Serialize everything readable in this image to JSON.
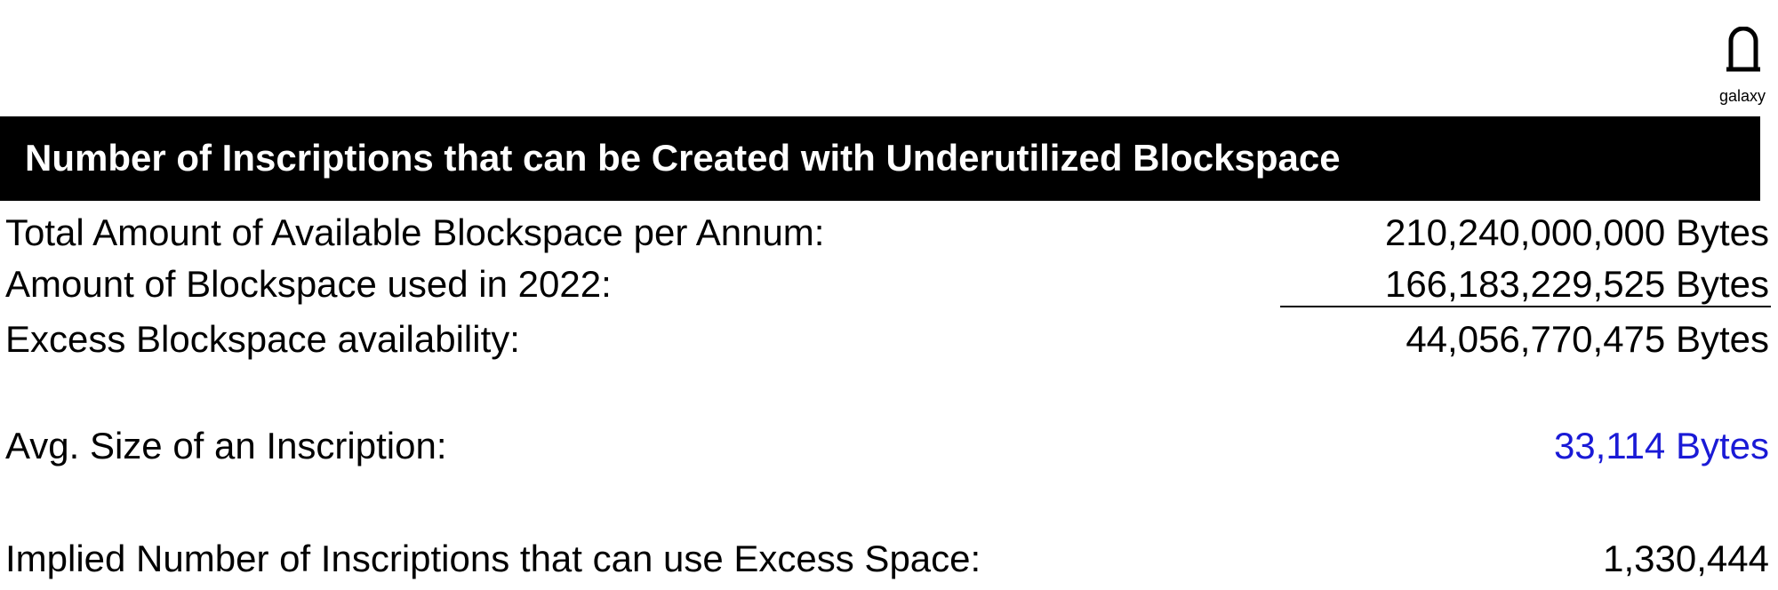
{
  "logo": {
    "icon": "galaxy-logo-icon",
    "text": "galaxy"
  },
  "header": {
    "title": "Number of Inscriptions that can be Created with Underutilized Blockspace"
  },
  "rows": [
    {
      "label": "Total Amount of Available Blockspace per Annum:",
      "value": "210,240,000,000 Bytes"
    },
    {
      "label": "Amount of Blockspace used in 2022:",
      "value": "166,183,229,525 Bytes"
    },
    {
      "label": "Excess Blockspace availability:",
      "value": "44,056,770,475 Bytes"
    },
    {
      "label": "Avg. Size of an Inscription:",
      "value": "33,114 Bytes"
    },
    {
      "label": "Implied Number of Inscriptions that can use Excess Space:",
      "value": "1,330,444"
    }
  ],
  "colors": {
    "header_bg": "#000000",
    "header_text": "#ffffff",
    "input_value": "#1a1ad6"
  }
}
